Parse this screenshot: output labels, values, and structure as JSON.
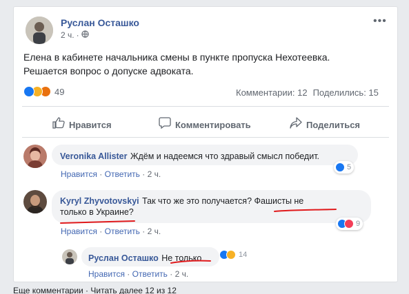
{
  "post": {
    "author": "Руслан Осташко",
    "time": "2 ч.",
    "text_line1": "Елена в кабинете начальника смены в пункте пропуска Нехотеевка.",
    "text_line2": "Решается вопрос о допуске адвоката.",
    "reaction_count": "49",
    "comments_count": "Комментарии: 12",
    "shares_count": "Поделились: 15"
  },
  "actions": {
    "like": "Нравится",
    "comment": "Комментировать",
    "share": "Поделиться"
  },
  "comments": [
    {
      "author": "Veronika Allister",
      "text": "Ждём и надеемся что здравый смысл победит.",
      "like_link": "Нравится",
      "reply_link": "Ответить",
      "time": "2 ч.",
      "reactions": "5"
    },
    {
      "author": "Kyryl Zhyvotovskyi",
      "text_line1": "Так что же это получается? Фашисты не",
      "text_line2": "только в Украине?",
      "like_link": "Нравится",
      "reply_link": "Ответить",
      "time": "2 ч.",
      "reactions": "9"
    },
    {
      "author": "Руслан Осташко",
      "text": "Не только",
      "like_link": "Нравится",
      "reply_link": "Ответить",
      "time": "2 ч.",
      "reactions": "14"
    }
  ],
  "footer_partial": "Еще комментарии · Читать далее 12 из 12",
  "colors": {
    "link_blue": "#385898",
    "like_blue": "#1877f2",
    "haha_yellow": "#f7b125",
    "angry_red": "#e9710f",
    "love_red": "#f33e58",
    "annotation_red": "#e0191b"
  }
}
